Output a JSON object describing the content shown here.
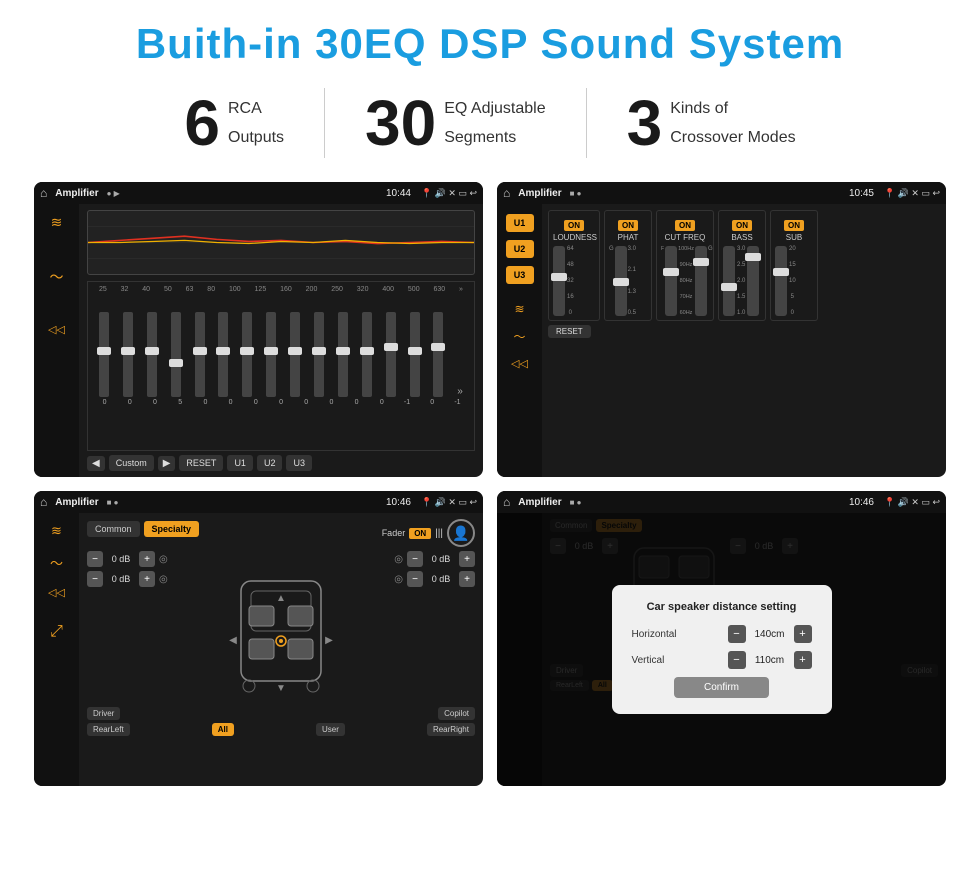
{
  "header": {
    "title": "Buith-in 30EQ DSP Sound System"
  },
  "stats": [
    {
      "number": "6",
      "text_line1": "RCA",
      "text_line2": "Outputs"
    },
    {
      "number": "30",
      "text_line1": "EQ Adjustable",
      "text_line2": "Segments"
    },
    {
      "number": "3",
      "text_line1": "Kinds of",
      "text_line2": "Crossover Modes"
    }
  ],
  "screen1": {
    "status_bar": {
      "app": "Amplifier",
      "time": "10:44"
    },
    "eq_freqs": [
      "25",
      "32",
      "40",
      "50",
      "63",
      "80",
      "100",
      "125",
      "160",
      "200",
      "250",
      "320",
      "400",
      "500",
      "630"
    ],
    "eq_values": [
      "0",
      "0",
      "0",
      "5",
      "0",
      "0",
      "0",
      "0",
      "0",
      "0",
      "0",
      "0",
      "-1",
      "0",
      "-1"
    ],
    "bottom_buttons": [
      "Custom",
      "RESET",
      "U1",
      "U2",
      "U3"
    ]
  },
  "screen2": {
    "status_bar": {
      "app": "Amplifier",
      "time": "10:45"
    },
    "u_buttons": [
      "U1",
      "U2",
      "U3"
    ],
    "controls": [
      {
        "on": true,
        "label": "LOUDNESS"
      },
      {
        "on": true,
        "label": "PHAT"
      },
      {
        "on": true,
        "label": "CUT FREQ"
      },
      {
        "on": true,
        "label": "BASS"
      },
      {
        "on": true,
        "label": "SUB"
      }
    ],
    "reset_label": "RESET"
  },
  "screen3": {
    "status_bar": {
      "app": "Amplifier",
      "time": "10:46"
    },
    "tabs": [
      {
        "label": "Common",
        "active": false
      },
      {
        "label": "Specialty",
        "active": true
      }
    ],
    "fader_label": "Fader",
    "fader_on": "ON",
    "seats": [
      {
        "label": "Driver",
        "side": "left"
      },
      {
        "label": "Copilot",
        "side": "right"
      },
      {
        "label": "RearLeft",
        "side": "left"
      },
      {
        "label": "All",
        "active": true
      },
      {
        "label": "User",
        "side": "center"
      },
      {
        "label": "RearRight",
        "side": "right"
      }
    ],
    "db_values": [
      "0 dB",
      "0 dB",
      "0 dB",
      "0 dB"
    ]
  },
  "screen4": {
    "status_bar": {
      "app": "Amplifier",
      "time": "10:46"
    },
    "tabs": [
      {
        "label": "Common",
        "active": false
      },
      {
        "label": "Specialty",
        "active": true
      }
    ],
    "dialog": {
      "title": "Car speaker distance setting",
      "rows": [
        {
          "label": "Horizontal",
          "value": "140cm"
        },
        {
          "label": "Vertical",
          "value": "110cm"
        }
      ],
      "confirm_label": "Confirm"
    },
    "db_values": [
      "0 dB",
      "0 dB"
    ]
  },
  "icons": {
    "home": "⌂",
    "pin": "📍",
    "speaker": "🔊",
    "back": "↩",
    "person": "👤",
    "equalizer": "≋",
    "wave": "〜",
    "arrow_left": "◀",
    "arrow_right": "▶"
  }
}
